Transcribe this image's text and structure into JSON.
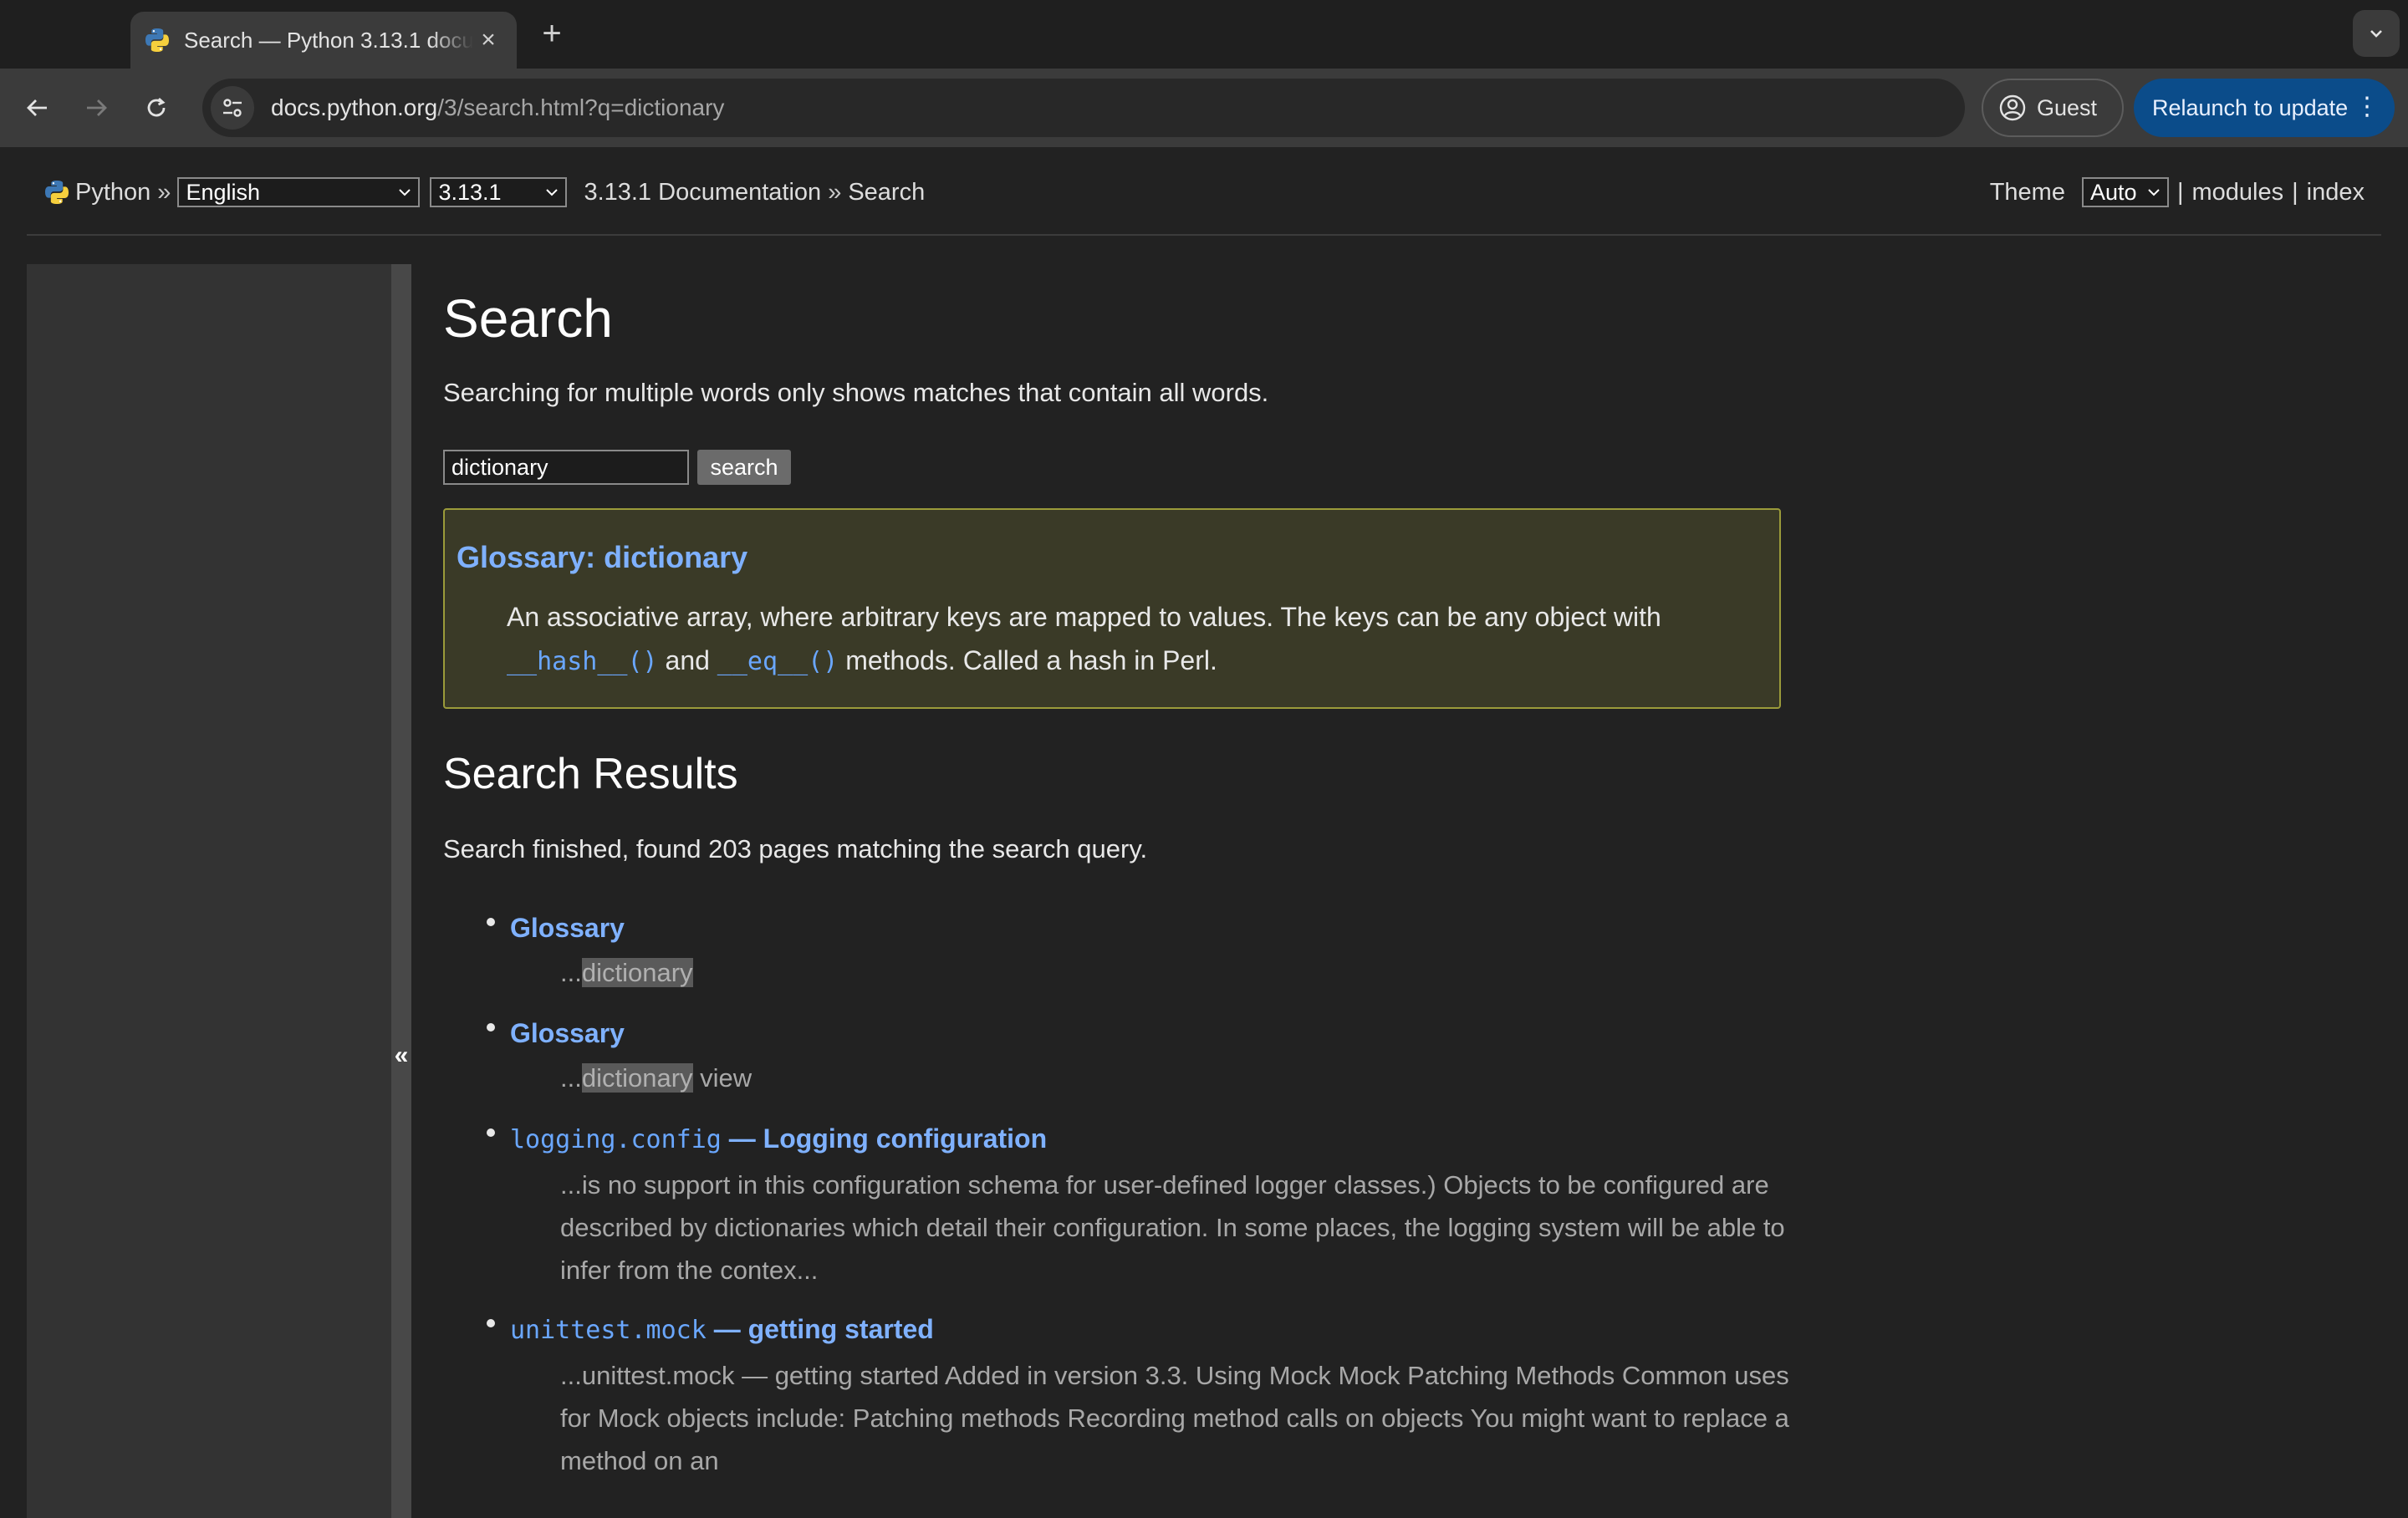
{
  "browser": {
    "tab_title": "Search — Python 3.13.1 documentation",
    "new_tab": "+",
    "url_host": "docs.python.org",
    "url_path": "/3/search.html?q=dictionary",
    "guest_label": "Guest",
    "relaunch_label": "Relaunch to update",
    "accent": "#0b4c8a"
  },
  "related_bar": {
    "python_label": "Python",
    "sep1": "»",
    "language": "English",
    "version": "3.13.1",
    "doc_link": "3.13.1 Documentation",
    "sep2": "»",
    "current": "Search",
    "theme_label": "Theme",
    "theme_value": "Auto",
    "pipe": "|",
    "modules": "modules",
    "index": "index"
  },
  "sidebar": {
    "collapse_label": "«"
  },
  "search": {
    "heading": "Search",
    "note": "Searching for multiple words only shows matches that contain all words.",
    "query": "dictionary",
    "button": "search"
  },
  "glossary": {
    "title": "Glossary: dictionary",
    "text_1": "An associative array, where arbitrary keys are mapped to values. The keys can be any object with",
    "code_1": "__hash__()",
    "text_and": "and",
    "code_2": "__eq__()",
    "text_2": "methods. Called a hash in Perl."
  },
  "results": {
    "heading": "Search Results",
    "status": "Search finished, found 203 pages matching the search query.",
    "items": [
      {
        "title": "Glossary",
        "snippet_pre": "...",
        "snippet_hl": "dictionary",
        "snippet_post": ""
      },
      {
        "title": "Glossary",
        "snippet_pre": "...",
        "snippet_hl": "dictionary",
        "snippet_post": " view"
      },
      {
        "title_code": "logging.config",
        "title_rest": " — Logging configuration",
        "snippet": "...is no support in this configuration schema for user-defined logger classes.) Objects to be config­ured are described by dictionaries which detail their configuration. In some places, the logging sys­tem will be able to infer from the contex..."
      },
      {
        "title_code": "unittest.mock",
        "title_rest": " — getting started",
        "snippet": "...unittest.mock — getting started Added in version 3.3. Using Mock Mock Patching Methods Common uses for Mock objects include: Patching methods Recording method calls on objects You might want to replace a method on an"
      }
    ]
  }
}
